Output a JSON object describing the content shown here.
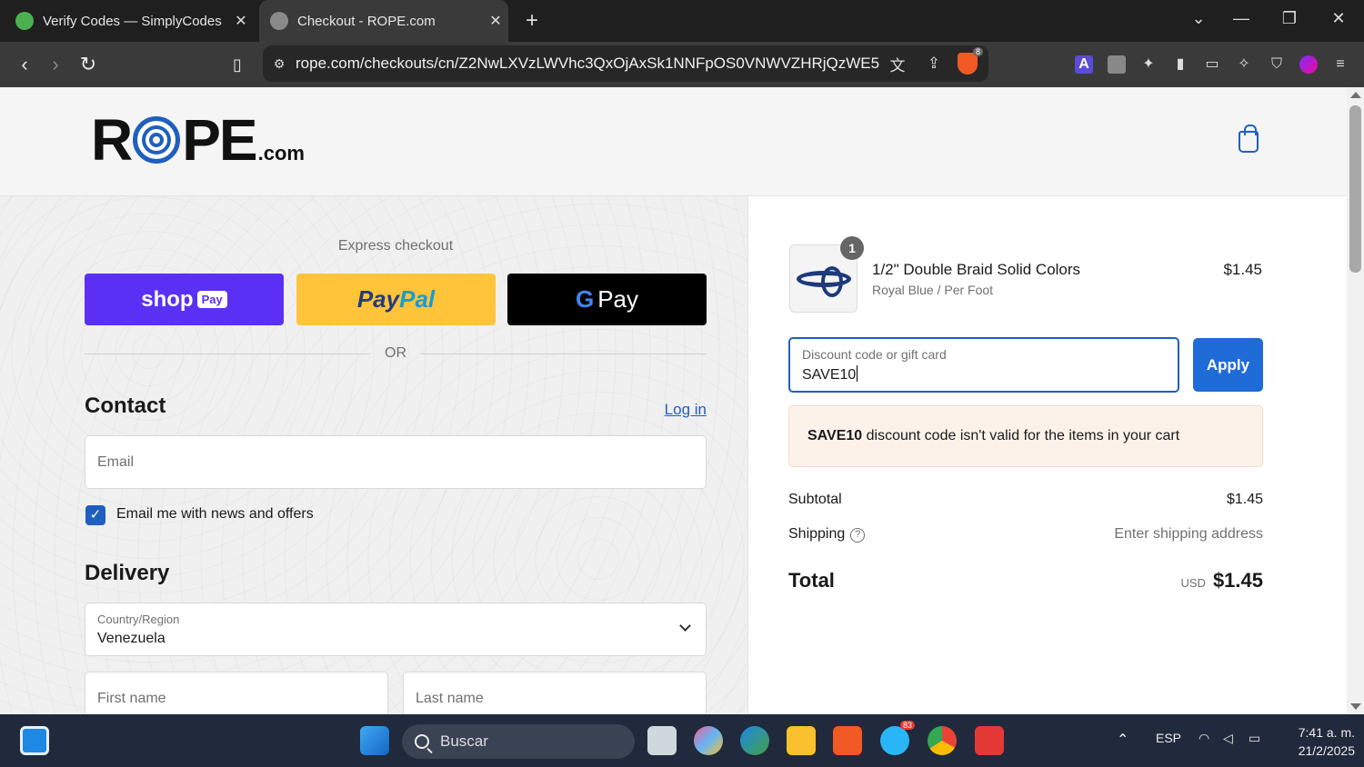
{
  "browser": {
    "tabs": [
      {
        "title": "Verify Codes — SimplyCodes",
        "active": false
      },
      {
        "title": "Checkout - ROPE.com",
        "active": true
      }
    ],
    "url": "rope.com/checkouts/cn/Z2NwLXVzLWVhc3QxOjAxSk1NNFpOS0VNWVZHRjQzWE5Y...",
    "brave_badge": "8"
  },
  "header": {
    "logo_main": "R",
    "logo_rest": "PE",
    "logo_domain": ".com"
  },
  "express": {
    "title": "Express checkout",
    "shop_pay_label": "shop",
    "shop_pay_pill": "Pay",
    "paypal_pay": "Pay",
    "paypal_pal": "Pal",
    "gpay_g": "G",
    "gpay_label": "Pay",
    "or_text": "OR"
  },
  "contact": {
    "heading": "Contact",
    "login_link": "Log in",
    "email_placeholder": "Email",
    "newsletter_label": "Email me with news and offers",
    "newsletter_checked": true
  },
  "delivery": {
    "heading": "Delivery",
    "country_label": "Country/Region",
    "country_value": "Venezuela",
    "first_name_placeholder": "First name",
    "last_name_placeholder": "Last name"
  },
  "order": {
    "item": {
      "quantity": "1",
      "name": "1/2\" Double Braid Solid Colors",
      "variant": "Royal Blue / Per Foot",
      "price": "$1.45"
    },
    "discount": {
      "label": "Discount code or gift card",
      "value": "SAVE10",
      "apply_label": "Apply"
    },
    "error": {
      "code": "SAVE10",
      "message": " discount code isn't valid for the items in your cart"
    },
    "subtotal_label": "Subtotal",
    "subtotal_value": "$1.45",
    "shipping_label": "Shipping",
    "shipping_value": "Enter shipping address",
    "total_label": "Total",
    "total_currency": "USD",
    "total_value": "$1.45"
  },
  "taskbar": {
    "search_placeholder": "Buscar",
    "language": "ESP",
    "time": "7:41 a. m.",
    "date": "21/2/2025",
    "telegram_badge": "83"
  },
  "colors": {
    "accent": "#1f5fbf",
    "shop_pay": "#5a31f4",
    "paypal": "#ffc439",
    "error_bg": "#fdf2ea"
  }
}
